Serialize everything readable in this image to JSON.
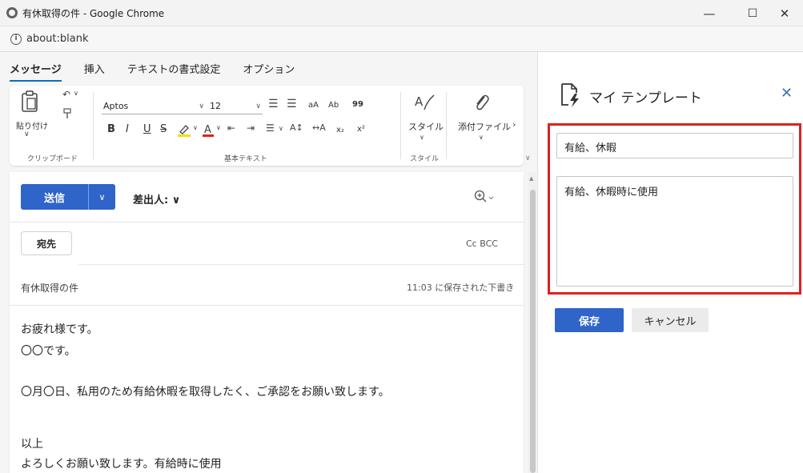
{
  "window": {
    "title": "有休取得の件 - Google Chrome",
    "minimize_glyph": "—",
    "maximize_glyph": "☐",
    "close_glyph": "✕"
  },
  "address": {
    "url": "about:blank",
    "info_glyph": "i"
  },
  "ribbon": {
    "tabs": [
      {
        "label": "メッセージ",
        "active": true
      },
      {
        "label": "挿入",
        "active": false
      },
      {
        "label": "テキストの書式設定",
        "active": false
      },
      {
        "label": "オプション",
        "active": false
      }
    ],
    "paste_label": "貼り付け",
    "clipboard_group": "クリップボード",
    "font_name": "Aptos",
    "font_size": "12",
    "basic_text_group": "基本テキスト",
    "style_label": "スタイル",
    "style_group": "スタイル",
    "attach_label": "添付ファイル",
    "format_glyphs": {
      "bold": "B",
      "italic": "I",
      "underline": "U",
      "strike": "S",
      "increase_font": "aA",
      "spelling": "Ab",
      "quote": "99",
      "subscript": "x₂",
      "superscript": "x²"
    }
  },
  "compose": {
    "send_label": "送信",
    "from_label": "差出人: ∨",
    "to_label": "宛先",
    "cc_bcc": "Cc  BCC",
    "subject": "有休取得の件",
    "saved_status": "11:03 に保存された下書き",
    "body_lines": [
      "お疲れ様です。",
      "〇〇です。",
      "〇月〇日、私用のため有給休暇を取得したく、ご承認をお願い致します。",
      "以上",
      "よろしくお願い致します。有給時に使用"
    ]
  },
  "template_panel": {
    "title": "マイ テンプレート",
    "close_glyph": "✕",
    "name_value": "有給、休暇",
    "body_value": "有給、休暇時に使用",
    "save_label": "保存",
    "cancel_label": "キャンセル",
    "highlight_color": "#e02020"
  },
  "colors": {
    "accent": "#2f64c8",
    "tab_underline": "#0f6cbd"
  }
}
